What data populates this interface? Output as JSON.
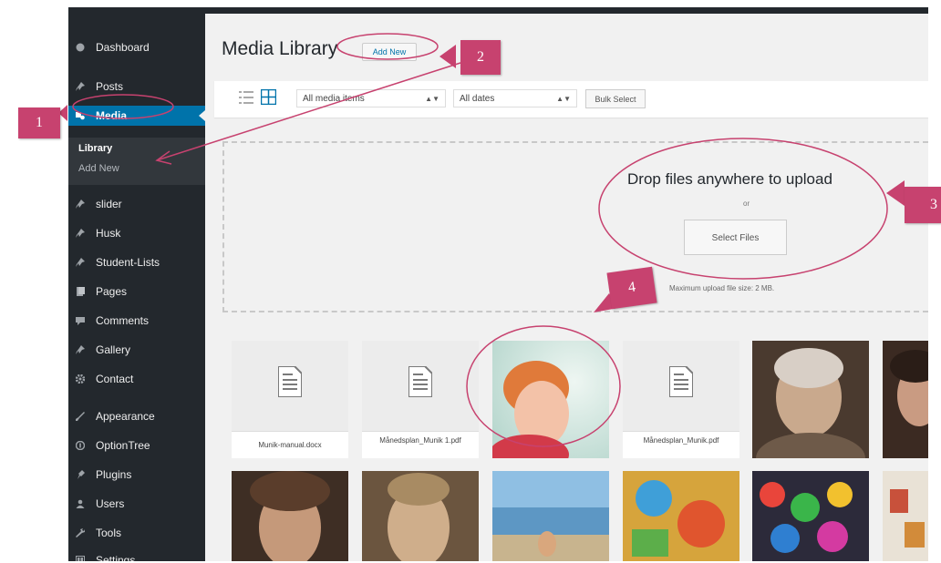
{
  "sidebar": {
    "items": [
      {
        "label": "Dashboard",
        "icon": "dashboard-icon"
      },
      {
        "label": "Posts",
        "icon": "pin-icon"
      },
      {
        "label": "Media",
        "icon": "media-icon",
        "active": true
      },
      {
        "label": "slider",
        "icon": "pin-icon"
      },
      {
        "label": "Husk",
        "icon": "pin-icon"
      },
      {
        "label": "Student-Lists",
        "icon": "pin-icon"
      },
      {
        "label": "Pages",
        "icon": "pages-icon"
      },
      {
        "label": "Comments",
        "icon": "comments-icon"
      },
      {
        "label": "Gallery",
        "icon": "pin-icon"
      },
      {
        "label": "Contact",
        "icon": "gear-icon"
      },
      {
        "label": "Appearance",
        "icon": "brush-icon"
      },
      {
        "label": "OptionTree",
        "icon": "optiontree-icon"
      },
      {
        "label": "Plugins",
        "icon": "plugins-icon"
      },
      {
        "label": "Users",
        "icon": "users-icon"
      },
      {
        "label": "Tools",
        "icon": "wrench-icon"
      },
      {
        "label": "Settings",
        "icon": "settings-icon"
      }
    ],
    "submenu": [
      "Library",
      "Add New"
    ]
  },
  "header": {
    "title": "Media Library",
    "add_new_label": "Add New"
  },
  "toolbar": {
    "media_filter": "All media items",
    "date_filter": "All dates",
    "bulk_select_label": "Bulk Select"
  },
  "uploader": {
    "title": "Drop files anywhere to upload",
    "or": "or",
    "select_files_label": "Select Files",
    "max_size": "Maximum upload file size: 2 MB."
  },
  "media_items": [
    {
      "type": "document",
      "filename": "Munik-manual.docx"
    },
    {
      "type": "document",
      "filename": "Månedsplan_Munik 1.pdf"
    },
    {
      "type": "image"
    },
    {
      "type": "document",
      "filename": "Månedsplan_Munik.pdf"
    },
    {
      "type": "image"
    },
    {
      "type": "image"
    },
    {
      "type": "image"
    },
    {
      "type": "image"
    },
    {
      "type": "image"
    },
    {
      "type": "image"
    },
    {
      "type": "image"
    },
    {
      "type": "image"
    }
  ],
  "annotations": [
    "1",
    "2",
    "3",
    "4"
  ],
  "colors": {
    "sidebar_bg": "#23282d",
    "active_blue": "#0073aa",
    "annotation_pink": "#c7426f"
  }
}
